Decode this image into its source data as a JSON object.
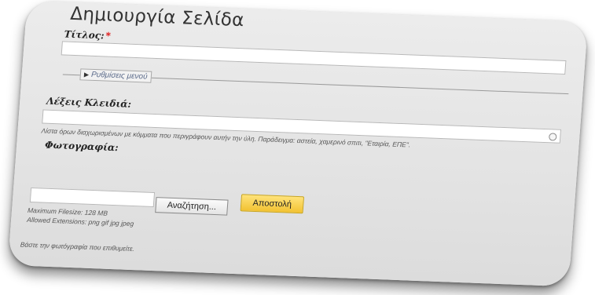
{
  "page": {
    "title": "Δημιουργία Σελίδα"
  },
  "form": {
    "title_label": "Τίτλος:",
    "required_mark": "*",
    "menu_settings_label": "Ρυθμίσεις μενού",
    "keywords_label": "Λέξεις Κλειδιά:",
    "keywords_hint": "Λίστα όρων διαχωρισμένων με κόμματα που περιγράφουν αυτήν την ύλη. Παράδειγμα: αστεία, χαμερινό σπιτι, \"Εταιρία, ΕΠΕ\".",
    "photo_label": "Φωτογραφία:",
    "browse_button": "Αναζήτηση...",
    "submit_button": "Αποστολή",
    "max_filesize": "Maximum Filesize: 128 MB",
    "allowed_extensions": "Allowed Extensions: png gif jpg jpeg",
    "photo_hint": "Βάστε την φωτόγραφία που επιθυμείτε."
  },
  "icons": {
    "menu_toggle": "triangle-right-icon",
    "autocomplete": "autocomplete-circle-icon"
  },
  "colors": {
    "submit_bg": "#f2c232",
    "required": "#dd0000"
  }
}
